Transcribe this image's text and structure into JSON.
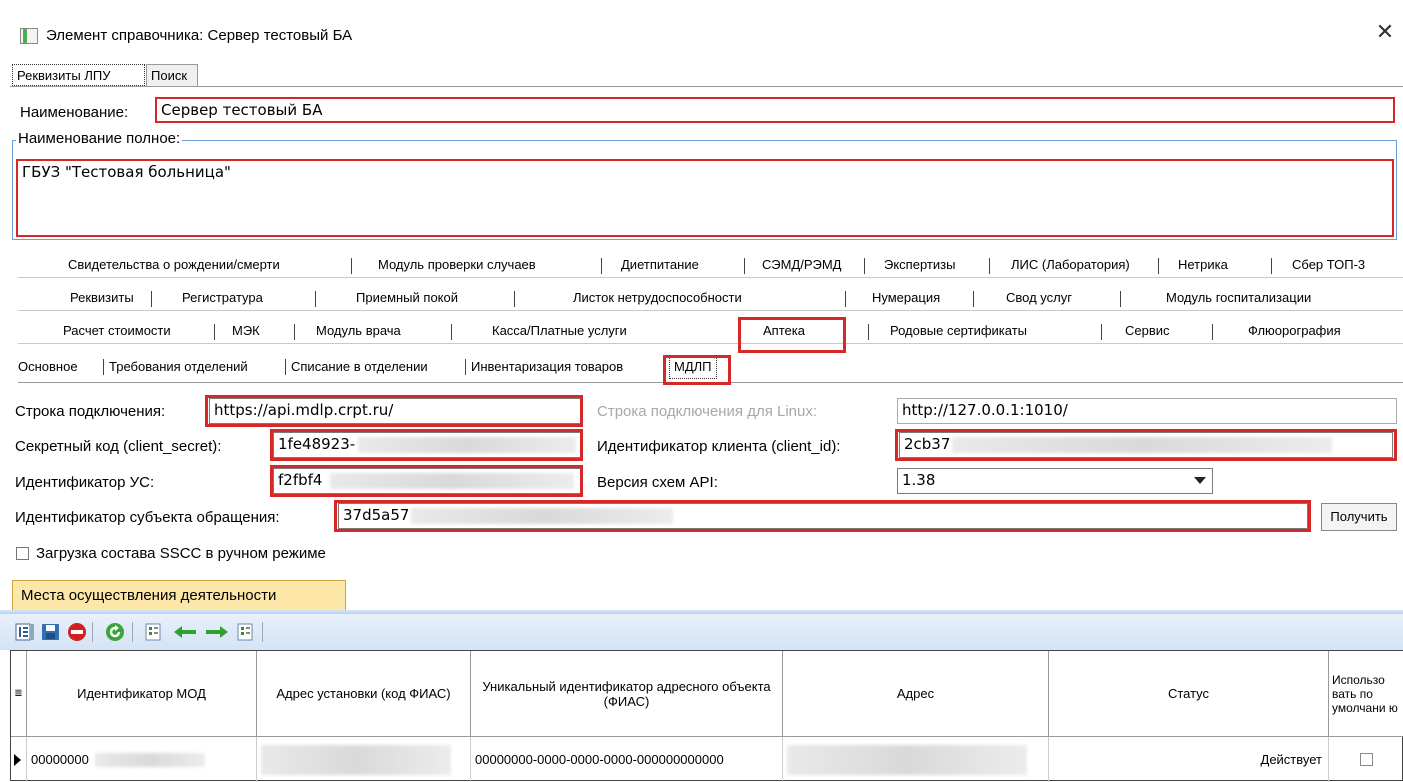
{
  "window": {
    "title": "Элемент справочника: Сервер тестовый БА",
    "close_glyph": "✕"
  },
  "top_tabs": [
    {
      "label": "Реквизиты ЛПУ"
    },
    {
      "label": "Поиск"
    }
  ],
  "name": {
    "label": "Наименование:",
    "value": "Сервер тестовый БА"
  },
  "full_name": {
    "label": "Наименование полное:",
    "value": "ГБУЗ \"Тестовая больница\""
  },
  "tab_rows": [
    [
      "Свидетельства о рождении/смерти",
      "Модуль проверки случаев",
      "Диетпитание",
      "СЭМД/РЭМД",
      "Экспертизы",
      "ЛИС (Лаборатория)",
      "Нетрика",
      "Сбер ТОП-3"
    ],
    [
      "Реквизиты",
      "Регистратура",
      "Приемный покой",
      "Листок нетрудоспособности",
      "Нумерация",
      "Свод услуг",
      "Модуль госпитализации"
    ],
    [
      "Расчет стоимости",
      "МЭК",
      "Модуль врача",
      "Касса/Платные услуги",
      "Аптека",
      "Родовые сертификаты",
      "Сервис",
      "Флюорография"
    ]
  ],
  "sub_tabs": [
    "Основное",
    "Требования отделений",
    "Списание в отделении",
    "Инвентаризация товаров",
    "МДЛП"
  ],
  "form": {
    "conn_label": "Строка подключения:",
    "conn_value": "https://api.mdlp.crpt.ru/",
    "linux_label": "Строка подключения для Linux:",
    "linux_value": "http://127.0.0.1:1010/",
    "secret_label": "Секретный код (client_secret):",
    "secret_value": "1fe48923-",
    "client_label": "Идентификатор клиента (client_id):",
    "client_value": "2cb37",
    "us_label": "Идентификатор УС:",
    "us_value": "f2fbf4",
    "api_label": "Версия схем API:",
    "api_value": "1.38",
    "subject_label": "Идентификатор субъекта обращения:",
    "subject_value": "37d5a57",
    "get_button": "Получить",
    "sscc_label": "Загрузка состава SSCC в ручном режиме"
  },
  "places": {
    "tab_label": "Места осуществления деятельности"
  },
  "grid": {
    "headers": [
      "Идентификатор МОД",
      "Адрес установки (код ФИАС)",
      "Уникальный идентификатор адресного объекта (ФИАС)",
      "Адрес",
      "Статус",
      "Использо вать по умолчани ю"
    ],
    "rows": [
      {
        "mod_id": "00000000",
        "fias_code": "",
        "fias_uid": "00000000-0000-0000-0000-000000000000",
        "address": "",
        "status": "Действует",
        "default": false
      }
    ]
  }
}
